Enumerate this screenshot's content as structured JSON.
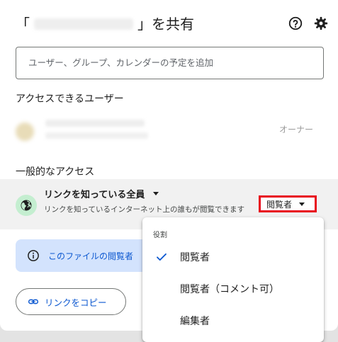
{
  "dialog": {
    "title_prefix": "「",
    "title_suffix": "」を共有",
    "add_people_placeholder": "ユーザー、グループ、カレンダーの予定を追加",
    "people_with_access_label": "アクセスできるユーザー",
    "owner": {
      "role": "オーナー"
    },
    "general_access_label": "一般的なアクセス",
    "general_access": {
      "title": "リンクを知っている全員",
      "description": "リンクを知っているインターネット上の誰もが閲覧できます",
      "role": "閲覧者"
    },
    "info_banner_text": "このファイルの閲覧者",
    "copy_link_label": "リンクをコピー"
  },
  "role_menu": {
    "header": "役割",
    "items": [
      {
        "label": "閲覧者",
        "selected": true
      },
      {
        "label": "閲覧者（コメント可）",
        "selected": false
      },
      {
        "label": "編集者",
        "selected": false
      }
    ]
  },
  "colors": {
    "accent": "#0b57d0",
    "highlight": "#e8081b",
    "globe_bg": "#c4eed0",
    "info_bg": "#d3e3fd"
  }
}
